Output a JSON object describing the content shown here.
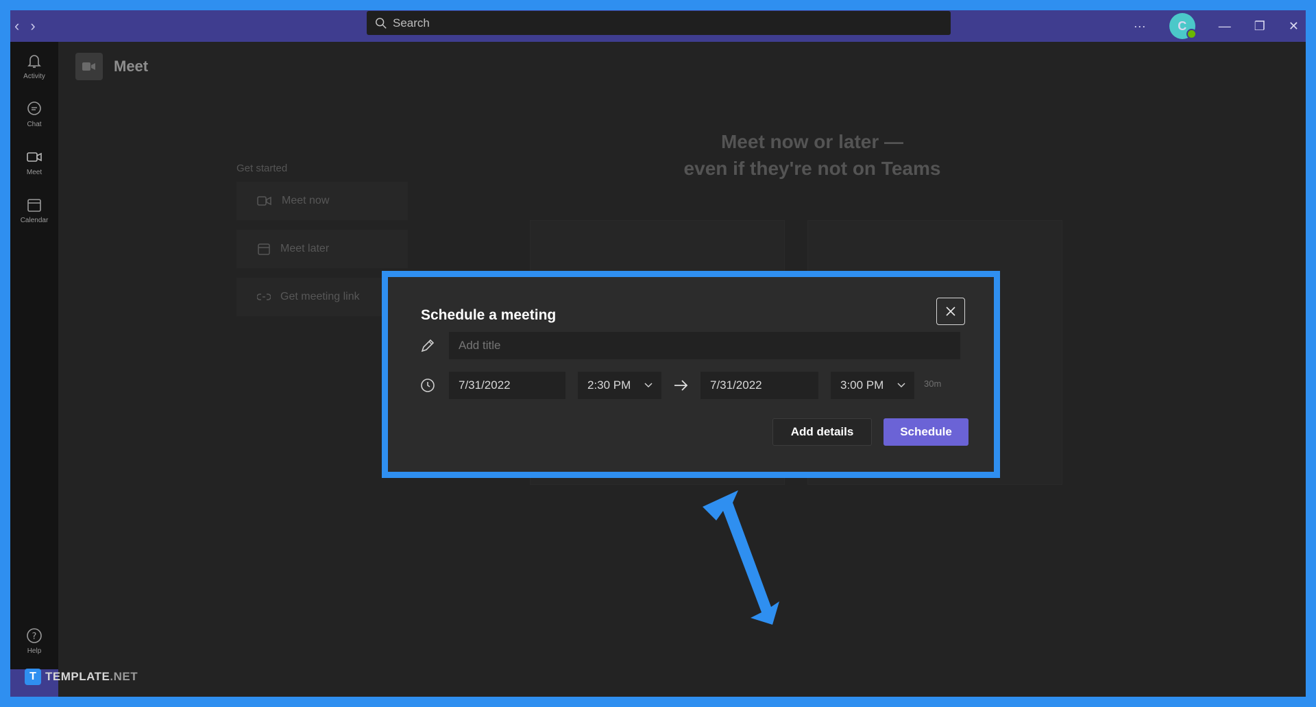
{
  "titlebar": {
    "back_glyph": "‹",
    "forward_glyph": "›",
    "search_placeholder": "Search",
    "more_glyph": "···",
    "avatar_initial": "C",
    "minimize_glyph": "—",
    "maximize_glyph": "❐",
    "close_glyph": "✕",
    "accent": "#3f3d8f"
  },
  "rail": {
    "items": [
      {
        "label": "Activity",
        "icon": "bell-icon"
      },
      {
        "label": "Chat",
        "icon": "chat-icon"
      },
      {
        "label": "Meet",
        "icon": "video-icon"
      },
      {
        "label": "Calendar",
        "icon": "calendar-icon"
      }
    ],
    "help_label": "Help"
  },
  "meet": {
    "title": "Meet",
    "get_started": "Get started",
    "buttons": [
      {
        "label": "Meet now",
        "icon": "video-icon"
      },
      {
        "label": "Meet later",
        "icon": "calendar-icon"
      },
      {
        "label": "Get meeting link",
        "icon": "link-icon"
      }
    ],
    "hero_line1": "Meet now or later —",
    "hero_line2": "even if they're not on Teams"
  },
  "dialog": {
    "title": "Schedule a meeting",
    "title_placeholder": "Add title",
    "start_date": "7/31/2022",
    "start_time": "2:30 PM",
    "end_date": "7/31/2022",
    "end_time": "3:00 PM",
    "duration": "30m",
    "add_details_label": "Add details",
    "schedule_label": "Schedule",
    "schedule_color": "#6b63d6"
  },
  "highlight_color": "#2f8ff0",
  "watermark": {
    "logo_letter": "T",
    "brand": "TEMPLATE",
    "suffix": ".NET"
  }
}
